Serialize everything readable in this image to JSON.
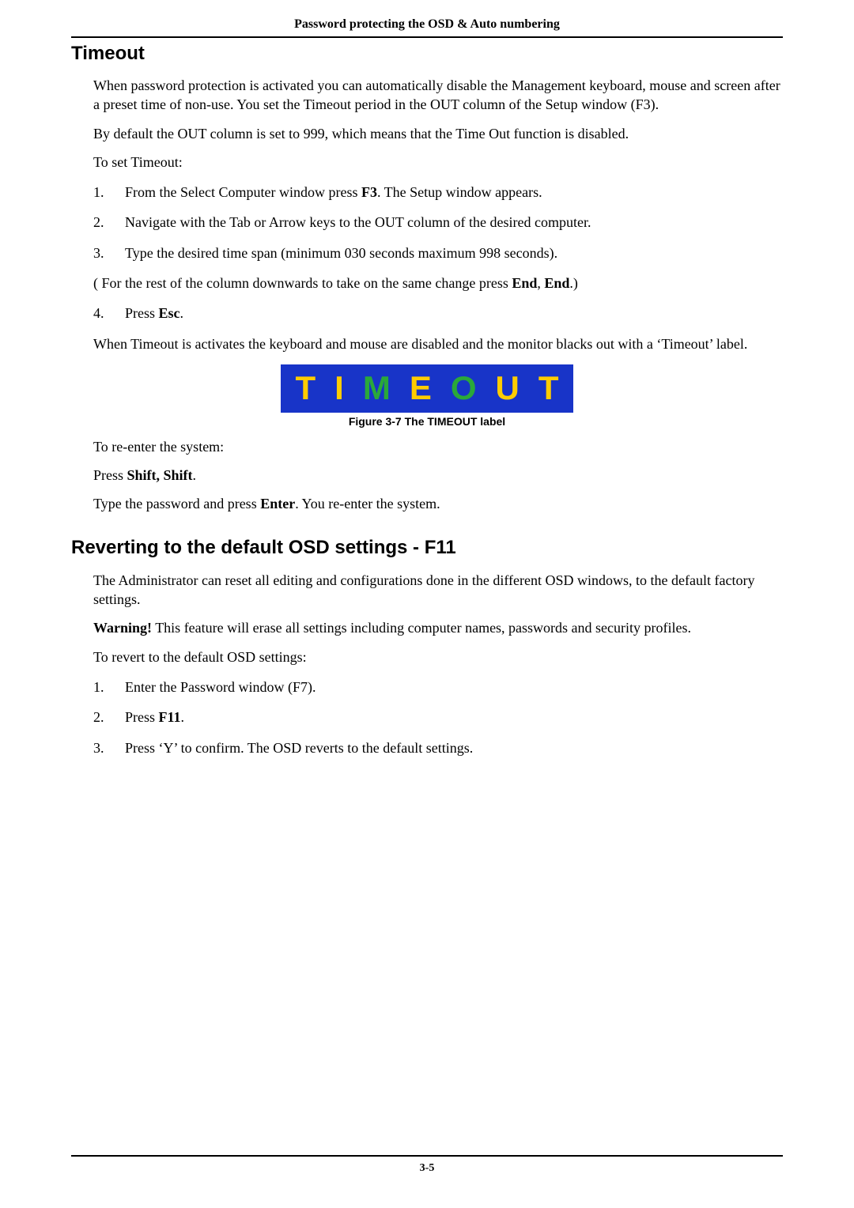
{
  "header": "Password protecting the OSD & Auto numbering",
  "section1": {
    "title": "Timeout",
    "p1a": "When password protection is activated you can automatically disable the Management keyboard, mouse and screen after a preset time of non-use. You set the Timeout period in the OUT column of the Setup window (F3).",
    "p2": "By default the OUT column is set to 999, which means that the Time Out function is disabled.",
    "p3": "To set Timeout:",
    "li1a": "From the Select Computer window press ",
    "li1b": "F3",
    "li1c": ". The Setup window appears.",
    "li2": "Navigate with the Tab or Arrow keys to the OUT column of the desired computer.",
    "li3": "Type the desired time span (minimum 030 seconds maximum 998 seconds).",
    "p4a": "( For the rest of the column downwards to take on the same change press ",
    "p4b": "End",
    "p4c": ", ",
    "p4d": "End",
    "p4e": ".)",
    "li4a": "Press ",
    "li4b": "Esc",
    "li4c": ".",
    "p5": "When Timeout is activates the keyboard and mouse are disabled and the monitor blacks out with a ‘Timeout’ label.",
    "caption": "Figure 3-7 The TIMEOUT label",
    "p6": "To re-enter the system:",
    "p7a": "Press ",
    "p7b": "Shift, Shift",
    "p7c": ".",
    "p8a": "Type the password and press ",
    "p8b": "Enter",
    "p8c": ". You re-enter the system."
  },
  "timeout_banner": {
    "c1": "T",
    "c2": "I",
    "c3": "M",
    "c4": "E",
    "c5": "O",
    "c6": "U",
    "c7": "T"
  },
  "section2": {
    "title": "Reverting to the default OSD settings - F11",
    "p1": "The Administrator can reset all editing and configurations done in the different OSD windows, to the default factory settings.",
    "p2a": "Warning!",
    "p2b": "  This feature will erase all settings including computer names, passwords and security profiles.",
    "p3": "To revert to the default OSD settings:",
    "li1": "Enter the Password window (F7).",
    "li2a": "Press ",
    "li2b": "F11",
    "li2c": ".",
    "li3": "Press ‘Y’ to confirm. The OSD reverts to the default settings."
  },
  "numbers": {
    "n1": "1.",
    "n2": "2.",
    "n3": "3.",
    "n4": "4."
  },
  "page_number": "3-5"
}
